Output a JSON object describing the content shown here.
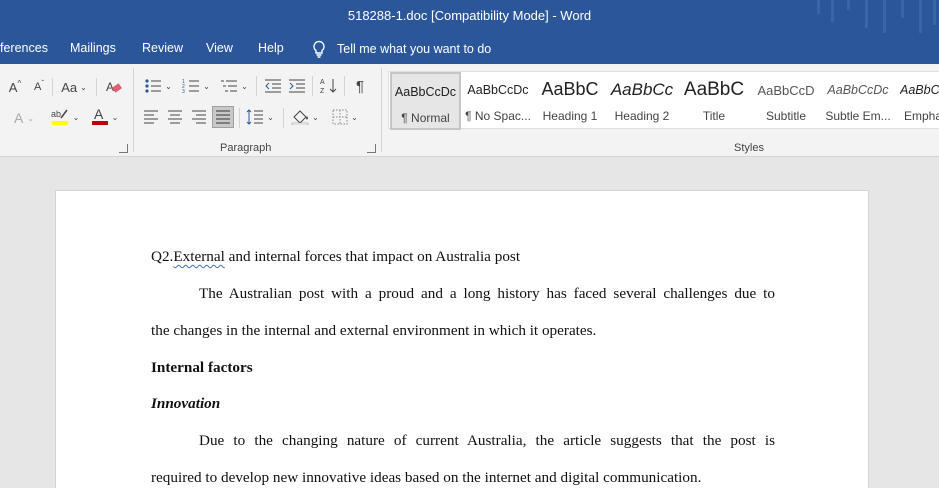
{
  "window": {
    "title": "518288-1.doc [Compatibility Mode]  -  Word"
  },
  "tabs": [
    "ferences",
    "Mailings",
    "Review",
    "View",
    "Help"
  ],
  "tell_me": {
    "placeholder": "Tell me what you want to do",
    "icon": "lightbulb-icon"
  },
  "ribbon": {
    "groups": {
      "paragraph": "Paragraph",
      "styles": "Styles"
    },
    "font_buttons": {
      "grow": "A",
      "shrink": "A",
      "change_case": "Aa",
      "text_effects": "A",
      "font_color": "A"
    },
    "highlight_color": "#ffff00",
    "font_color": "#c00000",
    "styles": [
      {
        "sample": "AaBbCcDc",
        "name": "¶ Normal"
      },
      {
        "sample": "AaBbCcDc",
        "name": "¶ No Spac..."
      },
      {
        "sample": "AaBbC",
        "name": "Heading 1"
      },
      {
        "sample": "AaBbCc",
        "name": "Heading 2"
      },
      {
        "sample": "AaBbC",
        "name": "Title"
      },
      {
        "sample": "AaBbCcD",
        "name": "Subtitle"
      },
      {
        "sample": "AaBbCcDc",
        "name": "Subtle Em..."
      },
      {
        "sample": "AaBbCc",
        "name": "Empha"
      }
    ]
  },
  "document": {
    "heading_prefix": "Q2.",
    "heading_squiggle": "External",
    "heading_rest": " and internal forces that impact on Australia post",
    "p1_line1": "The Australian post with a proud and a long history has faced several challenges due to",
    "p1_line2": "the changes in the internal and external environment in which it operates.",
    "internal_factors": "Internal factors",
    "innovation": "Innovation",
    "p2_line1": "Due to the changing nature of current Australia, the article suggests that the post is",
    "p2_line2": "required to develop new innovative ideas based on the internet and digital communication."
  },
  "colors": {
    "word_blue": "#2b579a",
    "ribbon_bg": "#f3f3f3",
    "canvas_bg": "#e6e6e6"
  }
}
